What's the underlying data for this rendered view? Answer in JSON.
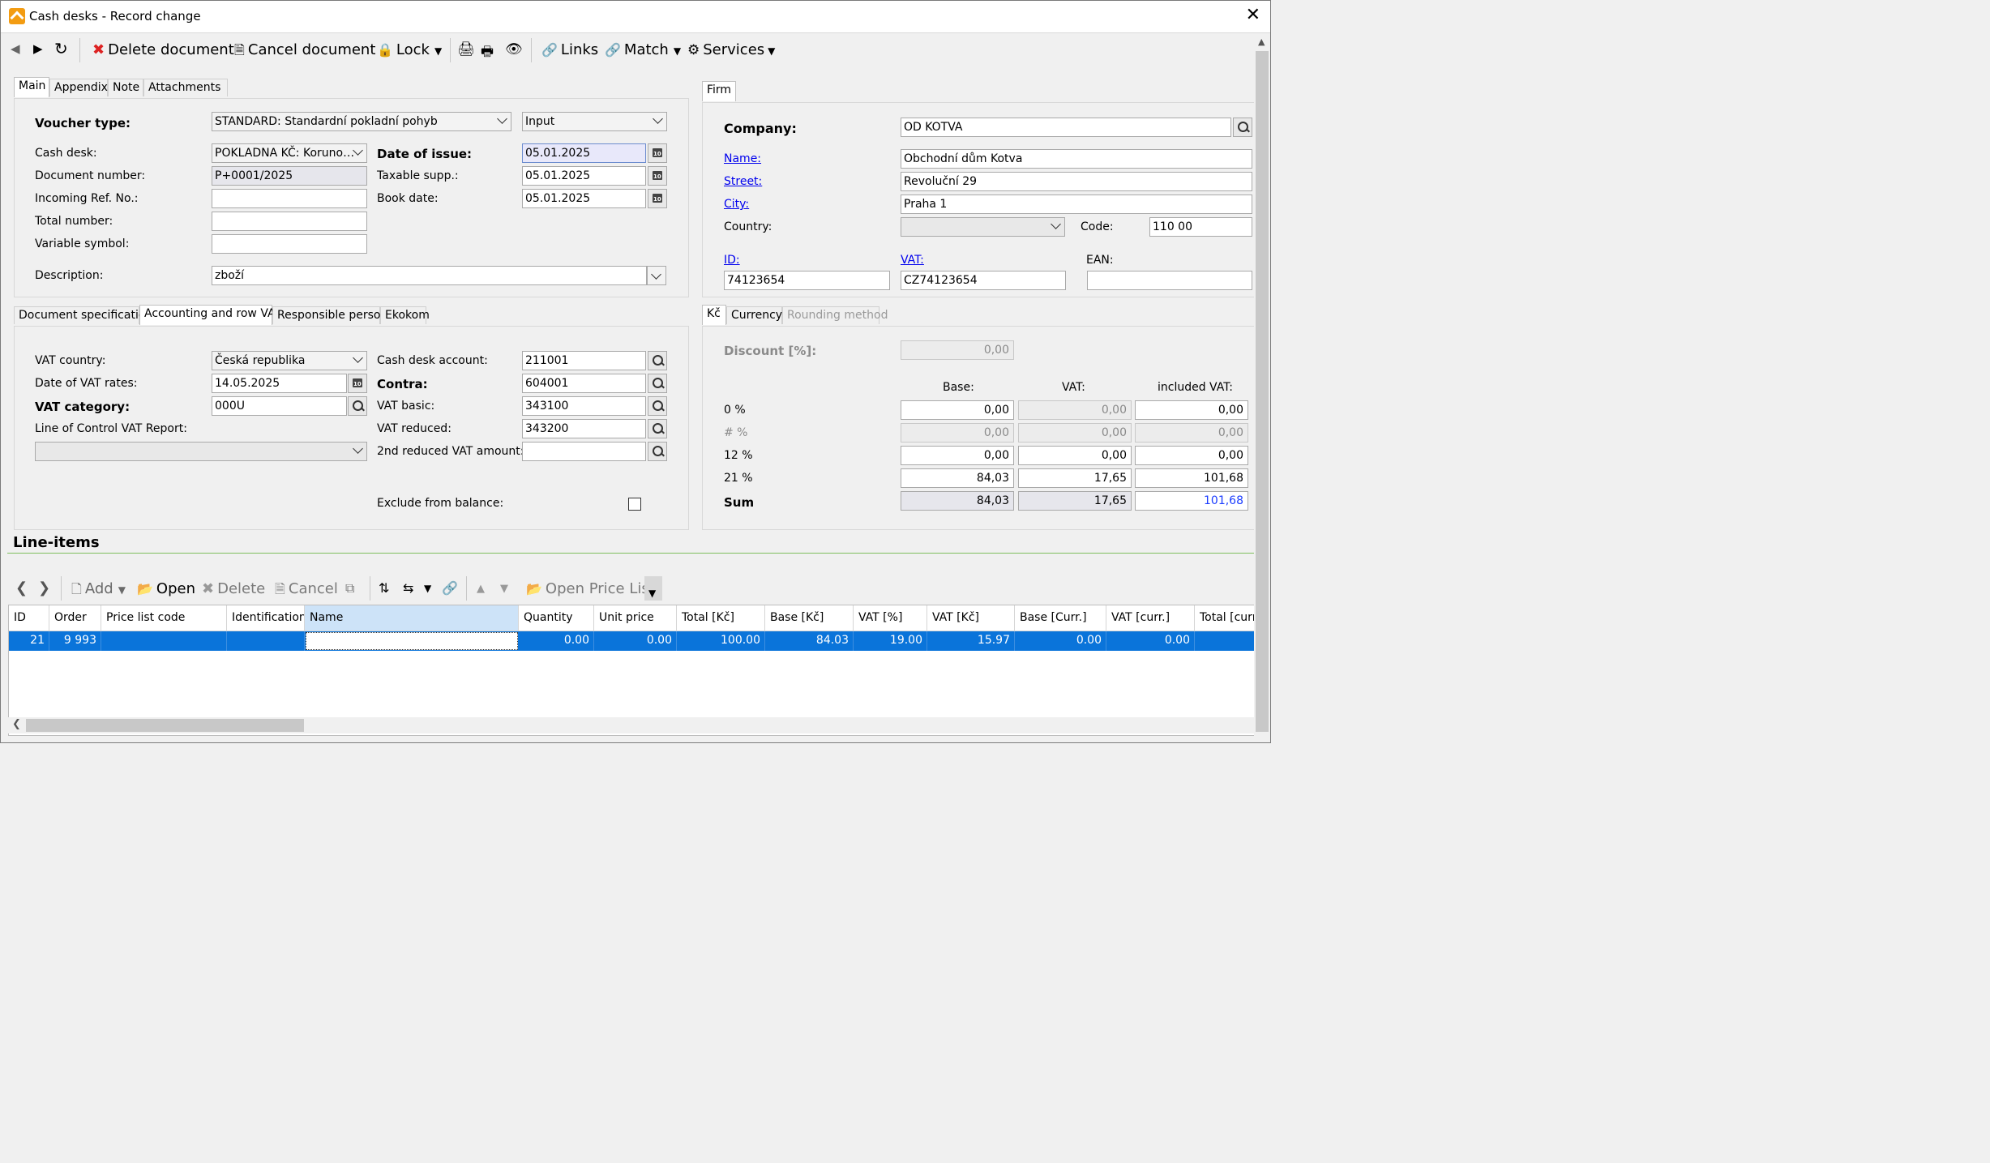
{
  "window": {
    "title": "Cash desks - Record change"
  },
  "toolbar": {
    "delete_document": "Delete document",
    "cancel_document": "Cancel document",
    "lock": "Lock",
    "links": "Links",
    "match": "Match",
    "services": "Services"
  },
  "main_tabs": [
    "Main",
    "Appendix",
    "Note",
    "Attachments"
  ],
  "main": {
    "voucher_type_label": "Voucher type:",
    "voucher_type_value": "STANDARD: Standardní pokladní pohyb",
    "direction_value": "Input",
    "cash_desk_label": "Cash desk:",
    "cash_desk_value": "POKLADNA KČ: Koruno…",
    "document_number_label": "Document number:",
    "document_number_value": "P+0001/2025",
    "incoming_ref_label": "Incoming Ref. No.:",
    "incoming_ref_value": "",
    "total_number_label": "Total number:",
    "total_number_value": "",
    "variable_symbol_label": "Variable symbol:",
    "variable_symbol_value": "",
    "description_label": "Description:",
    "description_value": "zboží",
    "date_of_issue_label": "Date of issue:",
    "date_of_issue_value": "05.01.2025",
    "taxable_supp_label": "Taxable supp.:",
    "taxable_supp_value": "05.01.2025",
    "book_date_label": "Book date:",
    "book_date_value": "05.01.2025"
  },
  "sub_tabs": [
    "Document specification",
    "Accounting and row VAT",
    "Responsible person",
    "Ekokom"
  ],
  "accounting": {
    "vat_country_label": "VAT country:",
    "vat_country_value": "Česká republika",
    "date_vat_rates_label": "Date of VAT rates:",
    "date_vat_rates_value": "14.05.2025",
    "vat_category_label": "VAT category:",
    "vat_category_value": "000U",
    "control_report_label": "Line of Control VAT Report:",
    "control_report_value": "",
    "cash_desk_account_label": "Cash desk account:",
    "cash_desk_account_value": "211001",
    "contra_label": "Contra:",
    "contra_value": "604001",
    "vat_basic_label": "VAT basic:",
    "vat_basic_value": "343100",
    "vat_reduced_label": "VAT reduced:",
    "vat_reduced_value": "343200",
    "vat_2nd_label": "2nd reduced VAT amount:",
    "vat_2nd_value": "",
    "exclude_label": "Exclude from balance:"
  },
  "firm_tab": "Firm",
  "firm": {
    "company_label": "Company:",
    "company_value": "OD KOTVA",
    "name_label": "Name:",
    "name_value": "Obchodní dům Kotva",
    "street_label": "Street:",
    "street_value": "Revoluční 29",
    "city_label": "City:",
    "city_value": "Praha 1",
    "country_label": "Country:",
    "country_value": "",
    "code_label": "Code:",
    "code_value": "110 00",
    "id_label": "ID:",
    "id_value": "74123654",
    "vat_label": "VAT:",
    "vat_value": "CZ74123654",
    "ean_label": "EAN:",
    "ean_value": ""
  },
  "vat_tabs": [
    "Kč",
    "Currency",
    "Rounding method"
  ],
  "vat_summary": {
    "discount_label": "Discount [%]:",
    "discount_value": "0,00",
    "col_base": "Base:",
    "col_vat": "VAT:",
    "col_included": "included VAT:",
    "rows": [
      {
        "label": "0 %",
        "base": "0,00",
        "vat": "0,00",
        "included": "0,00"
      },
      {
        "label": "# %",
        "base": "0,00",
        "vat": "0,00",
        "included": "0,00"
      },
      {
        "label": "12 %",
        "base": "0,00",
        "vat": "0,00",
        "included": "0,00"
      },
      {
        "label": "21 %",
        "base": "84,03",
        "vat": "17,65",
        "included": "101,68"
      },
      {
        "label": "Sum",
        "base": "84,03",
        "vat": "17,65",
        "included": "101,68"
      }
    ]
  },
  "line_items": {
    "title": "Line-items",
    "toolbar": {
      "add": "Add",
      "open": "Open",
      "delete": "Delete",
      "cancel": "Cancel",
      "open_price_list": "Open Price List"
    },
    "columns": [
      "ID",
      "Order",
      "Price list code",
      "Identification",
      "Name",
      "Quantity",
      "Unit price",
      "Total [Kč]",
      "Base [Kč]",
      "VAT [%]",
      "VAT [Kč]",
      "Base [Curr.]",
      "VAT [curr.]",
      "Total [curr."
    ],
    "rows": [
      [
        "21",
        "9 993",
        "",
        "",
        "",
        "0.00",
        "0.00",
        "100.00",
        "84.03",
        "19.00",
        "15.97",
        "0.00",
        "0.00",
        ""
      ]
    ]
  }
}
